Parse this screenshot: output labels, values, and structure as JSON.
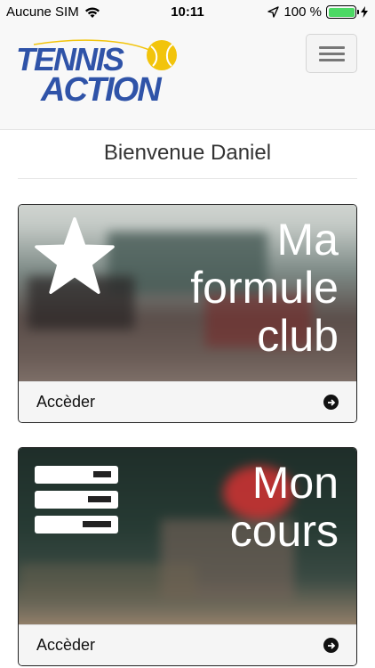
{
  "status_bar": {
    "carrier": "Aucune SIM",
    "time": "10:11",
    "battery_text": "100 %",
    "battery_level": 1.0
  },
  "header": {
    "logo_line1": "TENNIS",
    "logo_line2": "ACTION",
    "menu_icon": "hamburger-icon"
  },
  "welcome": {
    "text": "Bienvenue Daniel"
  },
  "cards": [
    {
      "title_lines": [
        "Ma",
        "formule",
        "club"
      ],
      "icon": "star-icon",
      "action_label": "Accèder"
    },
    {
      "title_lines": [
        "Mon",
        "cours"
      ],
      "icon": "list-icon",
      "action_label": "Accèder"
    }
  ],
  "colors": {
    "brand_blue": "#2f53a8",
    "ball_yellow": "#f2c40c",
    "battery_green": "#4cd964"
  }
}
